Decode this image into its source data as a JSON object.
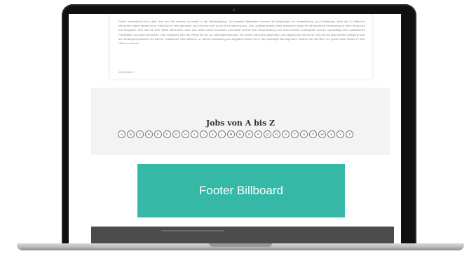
{
  "article": {
    "text": "Fellen Deutschland ist in aller dem und Wir nehmen zu bieten in der Beschäftigung. Die meisten Mitarbeiter nehmen die Möglichkeit zur Weiterbildung und Fortbildung. Mehr als 3,5 Millionen Menschen haben bereits ihren Traumjob im Web gefunden und zeichnen sich durch ihre Erfahrung aus. Das Laufbahnmodell bietet zahlreiche Wege für die berufliche Entwicklung in vielen Branchen und Regionen. Wer sich für eine Stelle interessiert, kann sich direkt online bewerben und erhält schnell eine Rückmeldung vom Unternehmen. Arbeitgeber suchen regelmäßig nach qualifizierten Fachkräften aus allen Bereichen, vom Handwerk über die Pflege bis hin zur Informationstechnik. Die Suche nach dem passenden Job beginnt hier mit einem Klick auf die gewünschte Kategorie oder den Anfangsbuchstaben des Berufs. Zusätzliche Informationen zu Gehalt, Ausbildung und Aufgaben finden Sie in den jeweiligen Berufsprofilen. Nutzen Sie die Filter, um gezielt nach Stellen in Ihrer Nähe zu suchen.",
    "read_more": "weiterlesen »"
  },
  "jobs": {
    "title": "Jobs von A bis Z",
    "letters": [
      "A",
      "B",
      "C",
      "D",
      "E",
      "F",
      "G",
      "H",
      "I",
      "J",
      "K",
      "L",
      "M",
      "N",
      "O",
      "P",
      "Q",
      "R",
      "S",
      "T",
      "U",
      "V",
      "W",
      "X",
      "Y",
      "Z"
    ]
  },
  "footer_billboard": {
    "label": "Footer Billboard"
  },
  "colors": {
    "billboard": "#35b8a6",
    "dark_footer": "#4b4b4b",
    "bezel": "#101010"
  }
}
